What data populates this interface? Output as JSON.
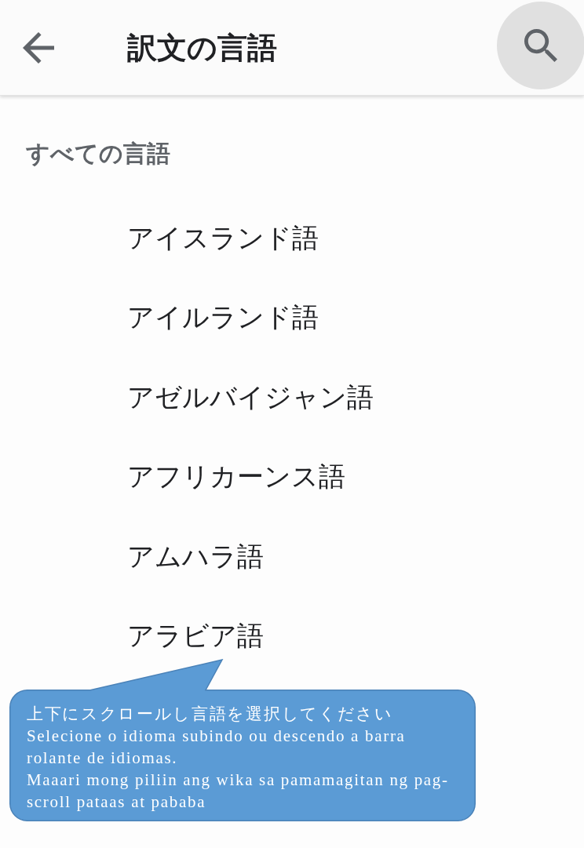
{
  "app_bar": {
    "title": "訳文の言語"
  },
  "section": {
    "title": "すべての言語"
  },
  "languages": [
    {
      "name": "アイスランド語"
    },
    {
      "name": "アイルランド語"
    },
    {
      "name": "アゼルバイジャン語"
    },
    {
      "name": "アフリカーンス語"
    },
    {
      "name": "アムハラ語"
    },
    {
      "name": "アラビア語"
    }
  ],
  "callout": {
    "paragraphs": [
      "上下にスクロールし言語を選択してください",
      "Selecione o idioma subindo ou descendo a barra rolante de idiomas.",
      "Maaari mong piliin ang wika sa pamamagitan ng pag-scroll pataas at pababa"
    ]
  }
}
